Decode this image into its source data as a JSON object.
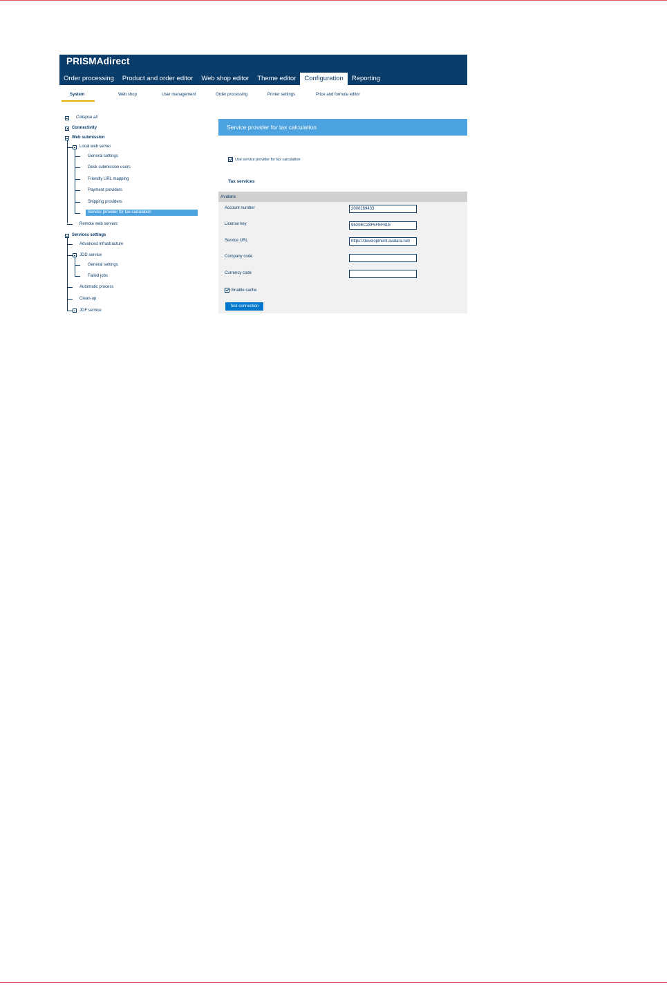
{
  "app": {
    "title": "PRISMAdirect"
  },
  "main_tabs": [
    {
      "label": "Order processing"
    },
    {
      "label": "Product and order editor"
    },
    {
      "label": "Web shop editor"
    },
    {
      "label": "Theme editor"
    },
    {
      "label": "Configuration",
      "active": true
    },
    {
      "label": "Reporting"
    }
  ],
  "sub_tabs": [
    {
      "label": "System",
      "active": true
    },
    {
      "label": "Web shop"
    },
    {
      "label": "User management"
    },
    {
      "label": "Order processing"
    },
    {
      "label": "Printer settings"
    },
    {
      "label": "Price and formula editor"
    }
  ],
  "tree": {
    "collapse_all": "Collapse all",
    "connectivity": "Connectivity",
    "web_submission": "Web submission",
    "local_web_server": "Local web server",
    "general_settings": "General settings",
    "desk_submission_users": "Desk submission users",
    "friendly_url_mapping": "Friendly URL mapping",
    "payment_providers": "Payment providers",
    "shipping_providers": "Shipping providers",
    "service_provider_tax": "Service provider for tax calculation",
    "remote_web_servers": "Remote web servers",
    "services_settings": "Services settings",
    "advanced_infrastructure": "Advanced infrastructure",
    "jdd_service": "JDD service",
    "jdd_general_settings": "General settings",
    "failed_jobs": "Failed jobs",
    "automatic_process": "Automatic process",
    "clean_up": "Clean-up",
    "jdf_service": "JDF service"
  },
  "panel": {
    "title": "Service provider for tax calculation",
    "use_service_provider_label": "Use service provider for tax calculation",
    "use_service_provider_checked": true,
    "tax_services_heading": "Tax services",
    "group_title": "Avalara",
    "fields": {
      "account_number": {
        "label": "Account number",
        "value": "2000169433"
      },
      "license_key": {
        "label": "License key",
        "value": "9820EC28F5FEF81E"
      },
      "service_url": {
        "label": "Service URL",
        "value": "https://development.avalara.net/"
      },
      "company_code": {
        "label": "Company code",
        "value": ""
      },
      "currency_code": {
        "label": "Currency code",
        "value": ""
      }
    },
    "enable_cache_label": "Enable cache",
    "enable_cache_checked": true,
    "test_connection_label": "Test connection"
  }
}
